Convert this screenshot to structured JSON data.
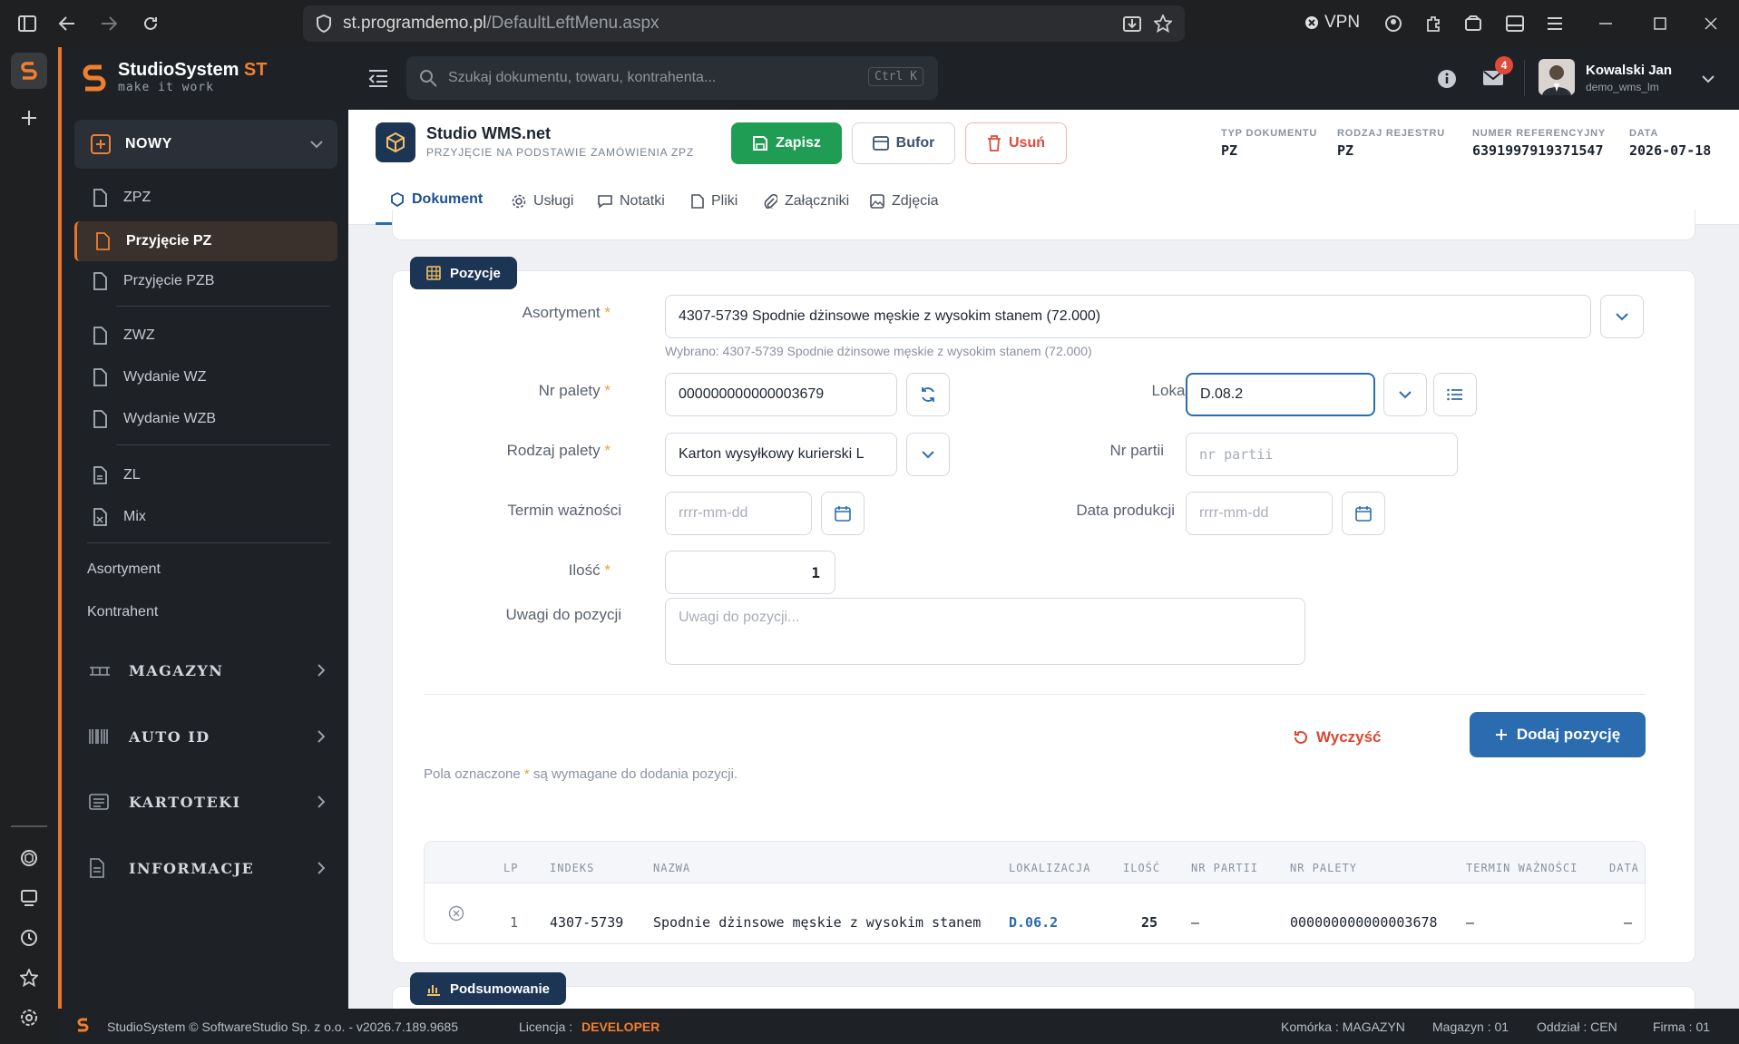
{
  "browser": {
    "url_host": "st.programdemo.pl",
    "url_path": "/DefaultLeftMenu.aspx",
    "vpn_label": "VPN"
  },
  "app": {
    "name": "StudioSystem",
    "name_suffix": "ST",
    "tagline": "make it work"
  },
  "search": {
    "placeholder": "Szukaj dokumentu, towaru, kontrahenta...",
    "shortcut": "Ctrl K"
  },
  "user": {
    "name": "Kowalski Jan",
    "login": "demo_wms_lm",
    "notifications": "4"
  },
  "sidebar": {
    "new_label": "NOWY",
    "items": [
      {
        "label": "ZPZ"
      },
      {
        "label": "Przyjęcie PZ"
      },
      {
        "label": "Przyjęcie PZB"
      },
      {
        "label": "ZWZ"
      },
      {
        "label": "Wydanie WZ"
      },
      {
        "label": "Wydanie WZB"
      },
      {
        "label": "ZL"
      },
      {
        "label": "Mix"
      }
    ],
    "links": [
      "Asortyment",
      "Kontrahent"
    ],
    "groups": [
      "MAGAZYN",
      "AUTO ID",
      "KARTOTEKI",
      "INFORMACJE"
    ]
  },
  "document": {
    "title": "Studio WMS.net",
    "subtitle": "PRZYJĘCIE NA PODSTAWIE ZAMÓWIENIA ZPZ",
    "buttons": {
      "save": "Zapisz",
      "buffer": "Bufor",
      "delete": "Usuń"
    },
    "meta": [
      {
        "label": "TYP DOKUMENTU",
        "value": "PZ"
      },
      {
        "label": "RODZAJ REJESTRU",
        "value": "PZ"
      },
      {
        "label": "NUMER REFERENCYJNY",
        "value": "6391997919371547"
      },
      {
        "label": "DATA",
        "value": "2026-07-18"
      }
    ],
    "tabs": [
      "Dokument",
      "Usługi",
      "Notatki",
      "Pliki",
      "Załączniki",
      "Zdjęcia"
    ]
  },
  "positions": {
    "badge": "Pozycje",
    "labels": {
      "assortment": "Asortyment",
      "pallet_no": "Nr palety",
      "location": "Lokalizacja",
      "pallet_type": "Rodzaj palety",
      "batch_no": "Nr partii",
      "expiry": "Termin ważności",
      "production_date": "Data produkcji",
      "quantity": "Ilość",
      "notes": "Uwagi do pozycji"
    },
    "values": {
      "assortment": "4307-5739 Spodnie dżinsowe męskie z wysokim stanem (72.000)",
      "assortment_hint": "Wybrano: 4307-5739 Spodnie dżinsowe męskie z wysokim stanem (72.000)",
      "pallet_no": "000000000000003679",
      "location": "D.08.2",
      "pallet_type": "Karton wysyłkowy kurierski L",
      "quantity": "1"
    },
    "placeholders": {
      "batch_no": "nr partii",
      "expiry": "rrrr-mm-dd",
      "production_date": "rrrr-mm-dd",
      "notes": "Uwagi do pozycji..."
    },
    "clear_label": "Wyczyść",
    "add_label": "Dodaj pozycję",
    "required_note_before": "Pola oznaczone",
    "required_note_after": "są wymagane do dodania pozycji.",
    "table": {
      "headers": [
        "LP",
        "INDEKS",
        "NAZWA",
        "LOKALIZACJA",
        "ILOŚĆ",
        "NR PARTII",
        "NR PALETY",
        "TERMIN WAŻNOŚCI",
        "DATA"
      ],
      "rows": [
        {
          "lp": "1",
          "index": "4307-5739",
          "name": "Spodnie dżinsowe męskie z wysokim stanem",
          "location": "D.06.2",
          "qty": "25",
          "batch": "—",
          "pallet": "000000000000003678",
          "expiry": "—",
          "date": "—"
        }
      ]
    }
  },
  "summary_badge": "Podsumowanie",
  "footer": {
    "copyright": "StudioSystem © SoftwareStudio Sp. z o.o. - v2026.7.189.9685",
    "license_label": "Licencja :",
    "license_value": "DEVELOPER",
    "cell": "Komórka : MAGAZYN",
    "warehouse": "Magazyn : 01",
    "branch": "Oddział : CEN",
    "company": "Firma : 01"
  },
  "colors": {
    "accent": "#e8742c",
    "primary": "#2b6cb0",
    "save": "#1f9d55",
    "danger": "#e04a3a",
    "sidebar": "#1e2227"
  }
}
